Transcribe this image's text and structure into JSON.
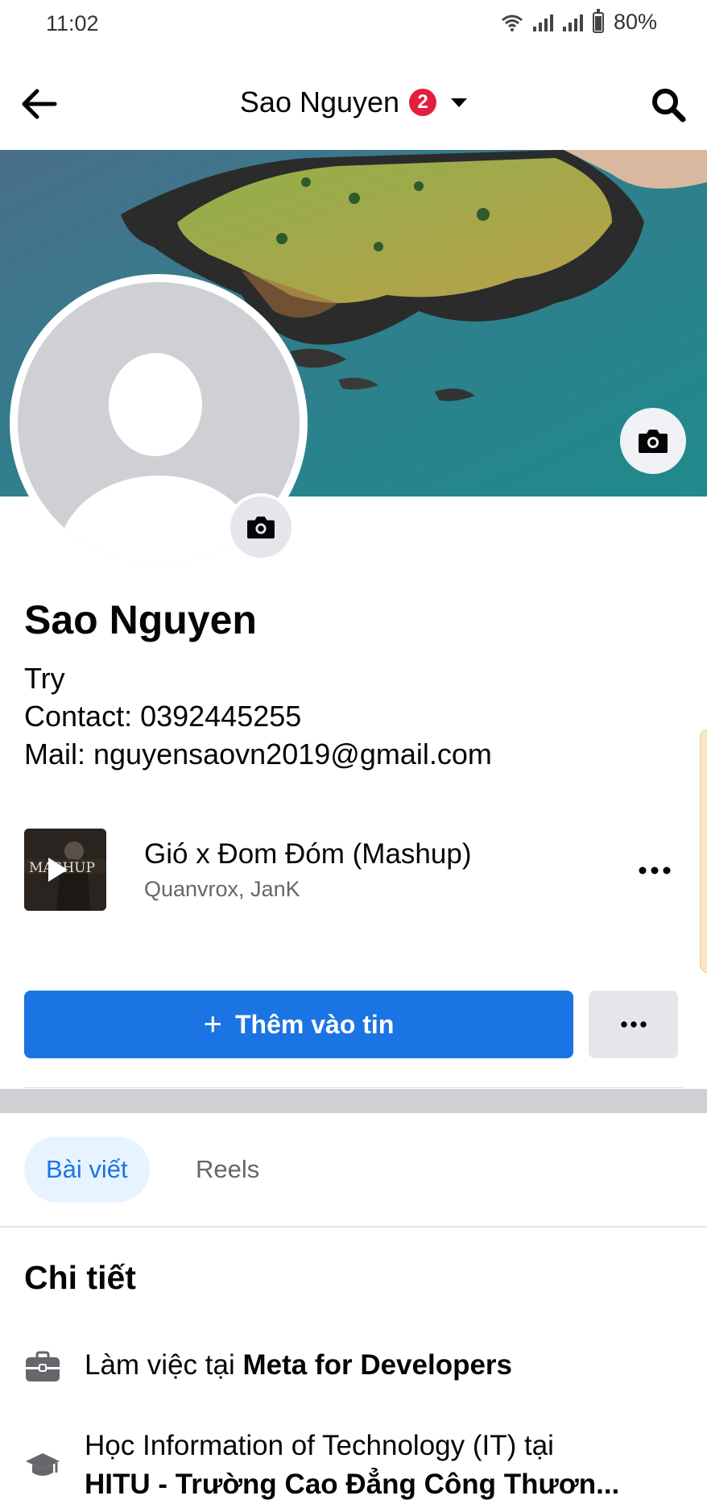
{
  "status_bar": {
    "time": "11:02",
    "battery": "80%",
    "battery_level": 0.8
  },
  "header": {
    "title": "Sao Nguyen",
    "badge_count": "2"
  },
  "profile": {
    "name": "Sao Nguyen",
    "bio": [
      "Try",
      "Contact: 0392445255",
      "Mail: nguyensaovn2019@gmail.com"
    ]
  },
  "music": {
    "title": "Gió x Đom Đóm (Mashup)",
    "artist": "Quanvrox, JanK"
  },
  "actions": {
    "add_story_label": "Thêm vào tin"
  },
  "tabs": {
    "posts": "Bài viết",
    "reels": "Reels"
  },
  "details": {
    "heading": "Chi tiết",
    "work_prefix": "Làm việc tại ",
    "work_place": "Meta for Developers",
    "edu_prefix": "Học Information of Technology (IT) tại",
    "edu_school": "HITU - Trường Cao Đẳng Công Thươn..."
  },
  "colors": {
    "primary": "#1b74e4",
    "badge": "#e41e3f",
    "tab_active_bg": "#e7f3ff"
  },
  "icons": [
    "back-arrow-icon",
    "search-icon",
    "camera-icon",
    "more-dots-icon",
    "briefcase-icon",
    "graduation-cap-icon",
    "play-icon"
  ]
}
